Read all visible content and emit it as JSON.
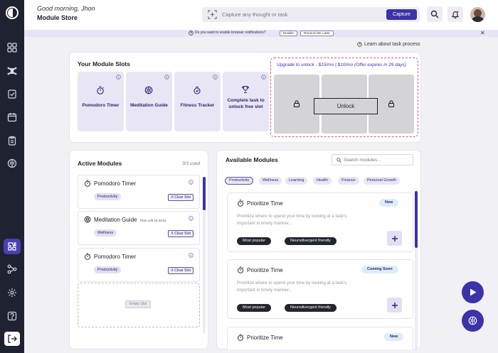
{
  "header": {
    "greeting": "Good morning, Jhon",
    "title": "Module Store",
    "capture_placeholder": "Capture any thought or task",
    "capture_button": "Capture",
    "search_icon": "search-icon",
    "notifications_icon": "bell-icon"
  },
  "notification_bar": {
    "message": "Do you want to enable browser notifications?",
    "enable_label": "Enable",
    "remind_label": "Remind Me Later"
  },
  "help_link": "Learn about task process",
  "module_slots": {
    "title": "Your Module Slots",
    "slots": [
      {
        "label": "Pomodoro Timer",
        "icon": "stopwatch-icon"
      },
      {
        "label": "Meditation Guide",
        "icon": "meditation-icon"
      },
      {
        "label": "Fitness Tracker",
        "icon": "fitness-icon"
      },
      {
        "label": "Complete task to unlock free slot",
        "icon": "trophy-icon"
      }
    ],
    "upgrade_text": "Upgrade to unlock - $15/mo | $10/mo (Offer expires in 29 days)",
    "unlock_label": "Unlock"
  },
  "active_modules": {
    "title": "Active Modules",
    "count": "3/3 used",
    "items": [
      {
        "name": "Pomodoro Timer",
        "timer": "",
        "tag": "Productivity",
        "clear": "X Clear Slot"
      },
      {
        "name": "Meditation Guide",
        "timer": "Time Left 22:34:51",
        "tag": "Wellness",
        "clear": "X Clear Slot"
      },
      {
        "name": "Pomodoro Timer",
        "timer": "",
        "tag": "Productivity",
        "clear": "X Clear Slot"
      }
    ],
    "empty_label": "Empty Slot"
  },
  "available_modules": {
    "title": "Available Modules",
    "search_placeholder": "Search modules...",
    "filters": [
      "Productivity",
      "Wellness",
      "Learning",
      "Health",
      "Finance",
      "Personal Growth"
    ],
    "items": [
      {
        "name": "Prioritize Time",
        "badge": "New",
        "desc": "Prioritize where to spend your time by looking at a task's important in timely manner...",
        "tags": [
          "Most popular",
          "Neurodivergent friendly"
        ]
      },
      {
        "name": "Prioritize Time",
        "badge": "Coming Soon",
        "desc": "Prioritize where to spend your time by looking at a task's important in timely manner...",
        "tags": [
          "Most popular",
          "Neurodivergent friendly"
        ]
      },
      {
        "name": "Prioritize Time",
        "badge": "New",
        "desc": "",
        "tags": []
      }
    ]
  },
  "colors": {
    "accent": "#3b33a8",
    "sidebar": "#1f2230",
    "slot_bg": "#e8e6f4",
    "upgrade_border": "#e0557a"
  }
}
